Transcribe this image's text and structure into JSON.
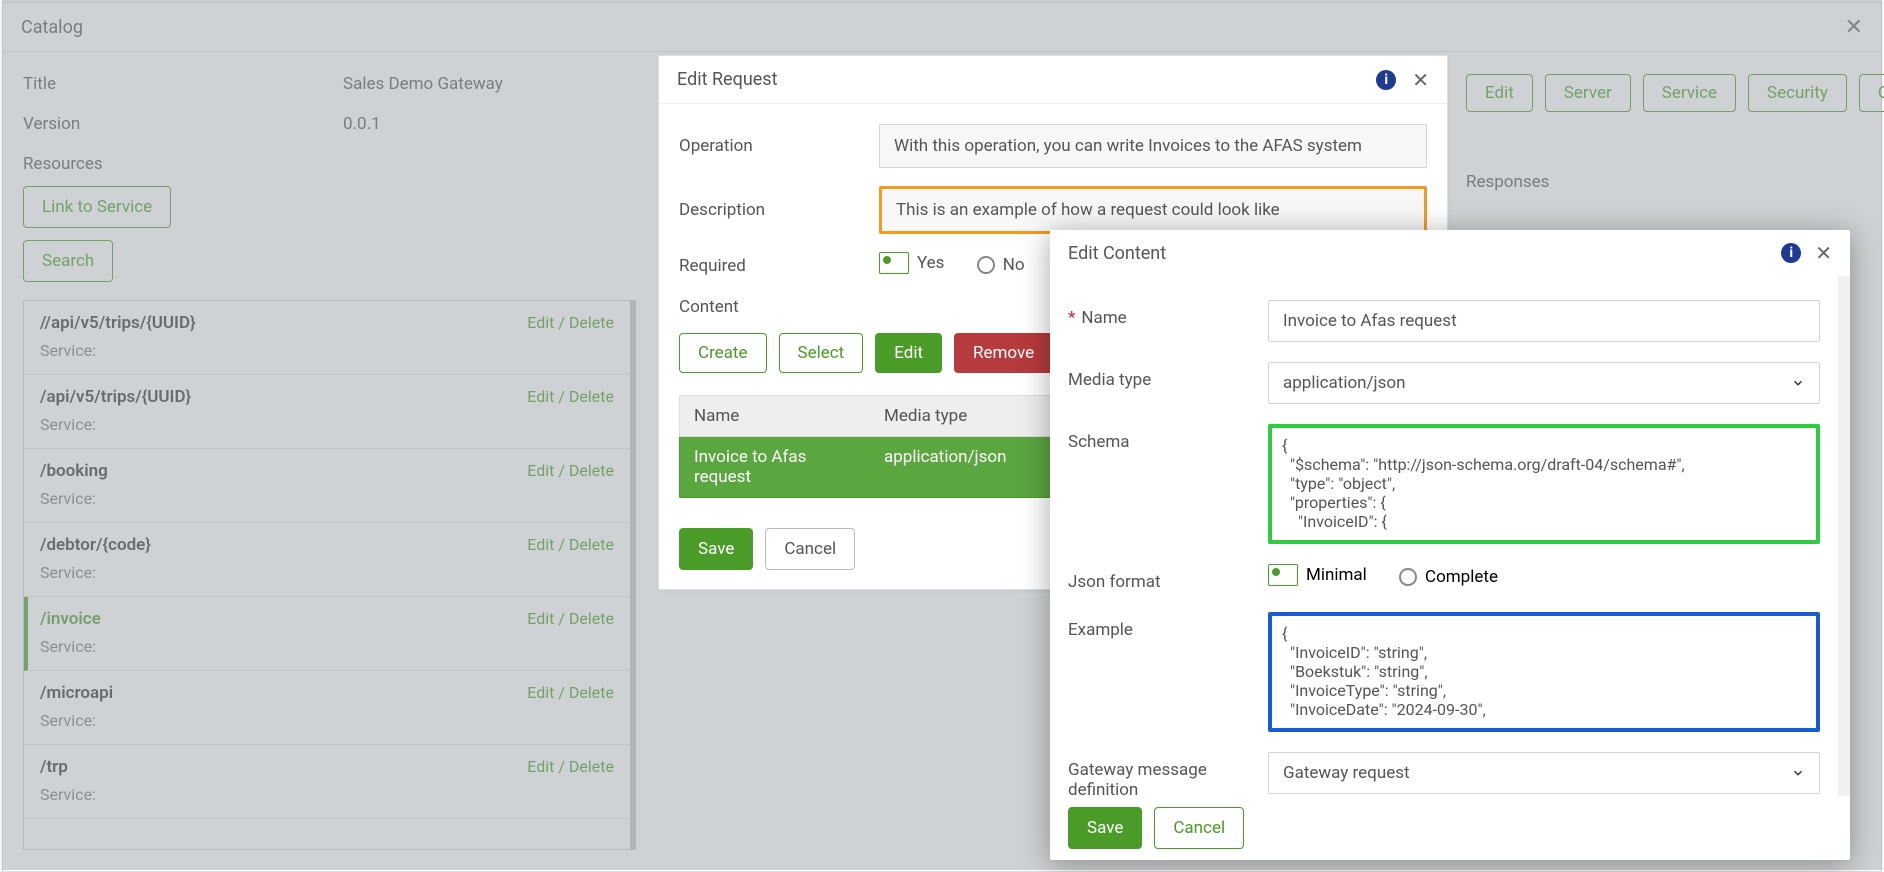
{
  "catalog": {
    "title": "Catalog",
    "fields": {
      "title_label": "Title",
      "title_value": "Sales Demo Gateway",
      "version_label": "Version",
      "version_value": "0.0.1",
      "resources_label": "Resources"
    },
    "buttons": {
      "link_to_service": "Link to Service",
      "search": "Search"
    },
    "resources": [
      {
        "path": "//api/v5/trips/{UUID}",
        "edit": "Edit",
        "delete": "Delete",
        "svc_label": "Service:",
        "active": false
      },
      {
        "path": "/api/v5/trips/{UUID}",
        "edit": "Edit",
        "delete": "Delete",
        "svc_label": "Service:",
        "active": false
      },
      {
        "path": "/booking",
        "edit": "Edit",
        "delete": "Delete",
        "svc_label": "Service:",
        "active": false
      },
      {
        "path": "/debtor/{code}",
        "edit": "Edit",
        "delete": "Delete",
        "svc_label": "Service:",
        "active": false
      },
      {
        "path": "/invoice",
        "edit": "Edit",
        "delete": "Delete",
        "svc_label": "Service:",
        "active": true
      },
      {
        "path": "/microapi",
        "edit": "Edit",
        "delete": "Delete",
        "svc_label": "Service:",
        "active": false
      },
      {
        "path": "/trp",
        "edit": "Edit",
        "delete": "Delete",
        "svc_label": "Service:",
        "active": false
      }
    ]
  },
  "right_tabs": {
    "edit": "Edit",
    "server": "Server",
    "service": "Service",
    "security": "Security",
    "contents": "Contents",
    "responses_label": "Responses"
  },
  "edit_request": {
    "title": "Edit Request",
    "operation_label": "Operation",
    "operation_value": "With this operation, you can write Invoices to the AFAS system",
    "description_label": "Description",
    "description_value": "This is an example of how a request could look like",
    "required_label": "Required",
    "yes": "Yes",
    "no": "No",
    "content_label": "Content",
    "btn_create": "Create",
    "btn_select": "Select",
    "btn_edit": "Edit",
    "btn_remove": "Remove",
    "col_name": "Name",
    "col_media": "Media type",
    "row_name": "Invoice to Afas request",
    "row_media": "application/json",
    "save": "Save",
    "cancel": "Cancel"
  },
  "edit_content": {
    "title": "Edit Content",
    "name_label": "Name",
    "name_value": "Invoice to Afas request",
    "media_label": "Media type",
    "media_value": "application/json",
    "schema_label": "Schema",
    "schema_code": "{\n  \"$schema\": \"http://json-schema.org/draft-04/schema#\",\n  \"type\": \"object\",\n  \"properties\": {\n    \"InvoiceID\": {",
    "json_format_label": "Json format",
    "format_minimal": "Minimal",
    "format_complete": "Complete",
    "example_label": "Example",
    "example_code": "{\n  \"InvoiceID\": \"string\",\n  \"Boekstuk\": \"string\",\n  \"InvoiceType\": \"string\",\n  \"InvoiceDate\": \"2024-09-30\",",
    "gw_label_1": "Gateway message",
    "gw_label_2": "definition",
    "gw_value": "Gateway request",
    "save": "Save",
    "cancel": "Cancel"
  }
}
